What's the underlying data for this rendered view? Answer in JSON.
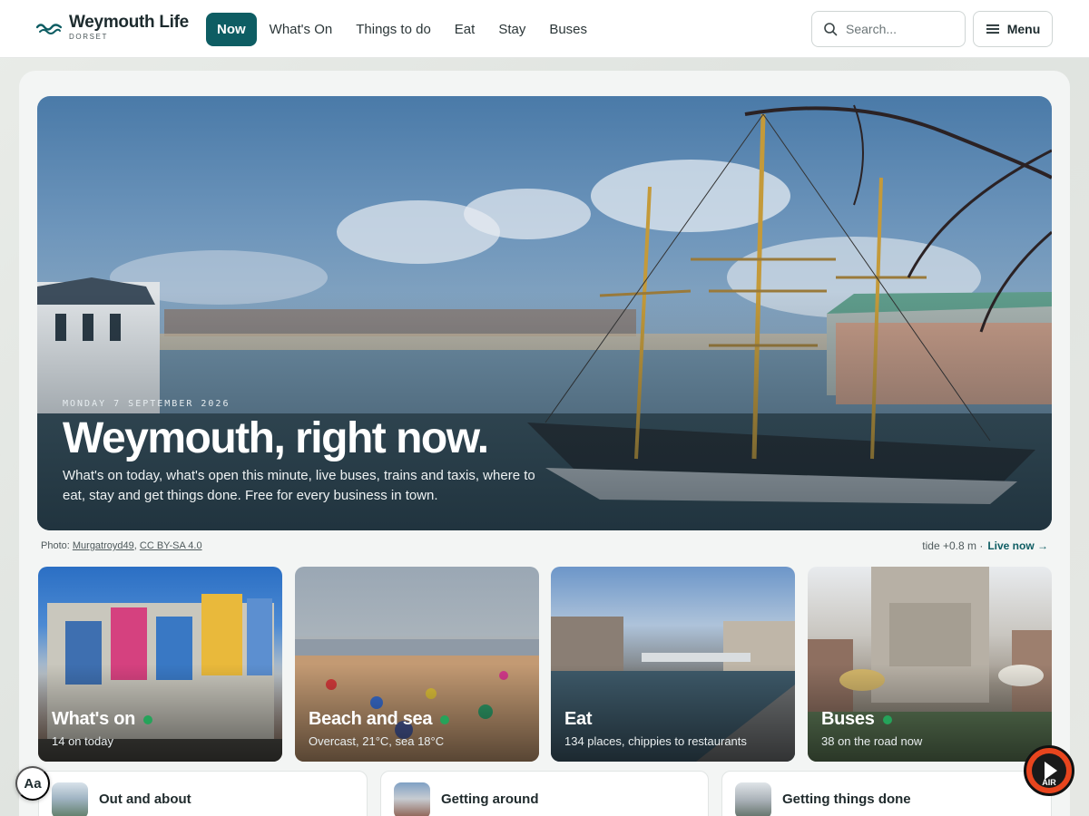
{
  "header": {
    "logo_title": "Weymouth Life",
    "logo_subtitle": "DORSET",
    "nav": [
      {
        "label": "Now",
        "active": true
      },
      {
        "label": "What's On"
      },
      {
        "label": "Things to do"
      },
      {
        "label": "Eat"
      },
      {
        "label": "Stay"
      },
      {
        "label": "Buses"
      }
    ],
    "search_placeholder": "Search...",
    "menu_label": "Menu"
  },
  "hero": {
    "date": "MONDAY 7 SEPTEMBER 2026",
    "title": "Weymouth, right now.",
    "description": "What's on today, what's open this minute, live buses, trains and taxis, where to eat, stay and get things done. Free for every business in town."
  },
  "credit": {
    "prefix": "Photo:",
    "author": "Murgatroyd49",
    "license": "CC BY-SA 4.0"
  },
  "tide": {
    "text": "tide +0.8 m ·",
    "live_label": "Live now"
  },
  "tiles": [
    {
      "title": "What's on",
      "subtitle": "14 on today",
      "live": true
    },
    {
      "title": "Beach and sea",
      "subtitle": "Overcast, 21°C, sea 18°C",
      "live": true
    },
    {
      "title": "Eat",
      "subtitle": "134 places, chippies to restaurants",
      "live": false
    },
    {
      "title": "Buses",
      "subtitle": "38 on the road now",
      "live": true
    }
  ],
  "bottom_cards": [
    {
      "label": "Out and about"
    },
    {
      "label": "Getting around"
    },
    {
      "label": "Getting things done"
    }
  ],
  "text_size_button": "Aa",
  "radio_label": "AIR",
  "colors": {
    "brand": "#0e5d63",
    "live_dot": "#25a35a"
  }
}
